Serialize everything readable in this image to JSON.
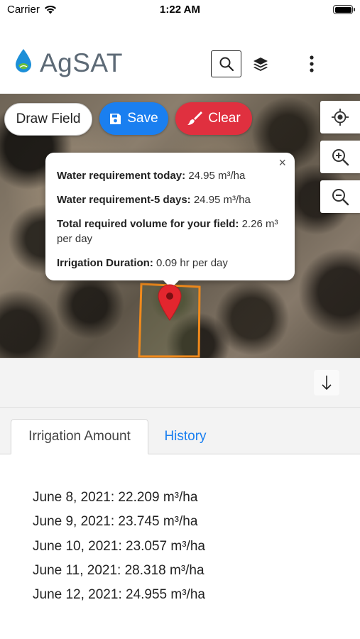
{
  "status_bar": {
    "carrier": "Carrier",
    "time": "1:22 AM"
  },
  "header": {
    "title": "AgSAT",
    "icons": [
      "search-icon",
      "layers-icon",
      "more-vertical-icon"
    ]
  },
  "map": {
    "buttons": {
      "draw": "Draw Field",
      "save": "Save",
      "clear": "Clear"
    },
    "controls": [
      "locate-icon",
      "zoom-in-icon",
      "zoom-out-icon"
    ],
    "popup": {
      "close": "×",
      "rows": [
        {
          "label": "Water requirement today:",
          "value": " 24.95 m³/ha"
        },
        {
          "label": "Water requirement-5 days:",
          "value": " 24.95 m³/ha"
        },
        {
          "label": "Total required volume for your field:",
          "value": " 2.26 m³ per day"
        },
        {
          "label": "Irrigation Duration:",
          "value": " 0.09 hr per day"
        }
      ]
    }
  },
  "sheet": {
    "tabs": [
      "Irrigation Amount",
      "History"
    ],
    "active_tab": "Irrigation Amount",
    "readings": [
      "June 8, 2021: 22.209 m³/ha",
      "June 9, 2021: 23.745 m³/ha",
      "June 10, 2021: 23.057 m³/ha",
      "June 11, 2021: 28.318 m³/ha",
      "June 12, 2021: 24.955 m³/ha"
    ]
  },
  "colors": {
    "primary": "#1a7ff0",
    "danger": "#e0303f",
    "field_outline": "#f08a1c",
    "pin": "#e3262e"
  }
}
